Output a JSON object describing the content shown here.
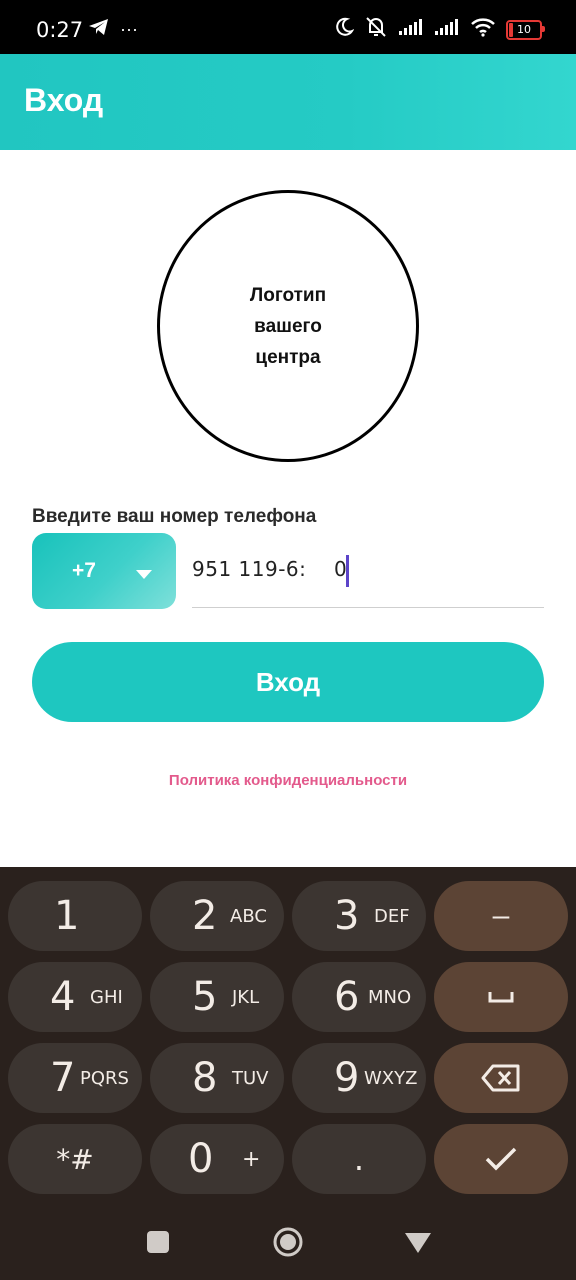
{
  "status_bar": {
    "time": "0:27",
    "more_icon": "···",
    "battery_level": "10",
    "icons": [
      "telegram-icon",
      "more-icon",
      "moon-icon",
      "muted-bell-icon",
      "signal-icon",
      "signal-icon",
      "wifi-icon",
      "battery-icon"
    ]
  },
  "app_bar": {
    "title": "Вход"
  },
  "logo": {
    "line1": "Логотип",
    "line2": "вашего",
    "line3": "центра"
  },
  "form": {
    "phone_label": "Введите ваш номер телефона",
    "country_code": "+7",
    "phone_value": "951 119-6:",
    "phone_value_end": "0",
    "login_button": "Вход",
    "privacy_link": "Политика конфиденциальности"
  },
  "keyboard": {
    "keys": [
      {
        "digit": "1",
        "letters": ""
      },
      {
        "digit": "2",
        "letters": "ABC"
      },
      {
        "digit": "3",
        "letters": "DEF"
      },
      {
        "digit": "4",
        "letters": "GHI"
      },
      {
        "digit": "5",
        "letters": "JKL"
      },
      {
        "digit": "6",
        "letters": "MNO"
      },
      {
        "digit": "7",
        "letters": "PQRS"
      },
      {
        "digit": "8",
        "letters": "TUV"
      },
      {
        "digit": "9",
        "letters": "WXYZ"
      },
      {
        "digit": "*#",
        "letters": ""
      },
      {
        "digit": "0",
        "letters": "+"
      },
      {
        "digit": ".",
        "letters": ""
      }
    ],
    "minus_key": "–",
    "colors": {
      "background": "#2a211d",
      "key": "#3c3531",
      "action_key": "#5c4435",
      "text": "#f3ece6"
    }
  },
  "colors": {
    "accent": "#1ec7c0",
    "link": "#e35a8c",
    "caret": "#5c44c9"
  }
}
